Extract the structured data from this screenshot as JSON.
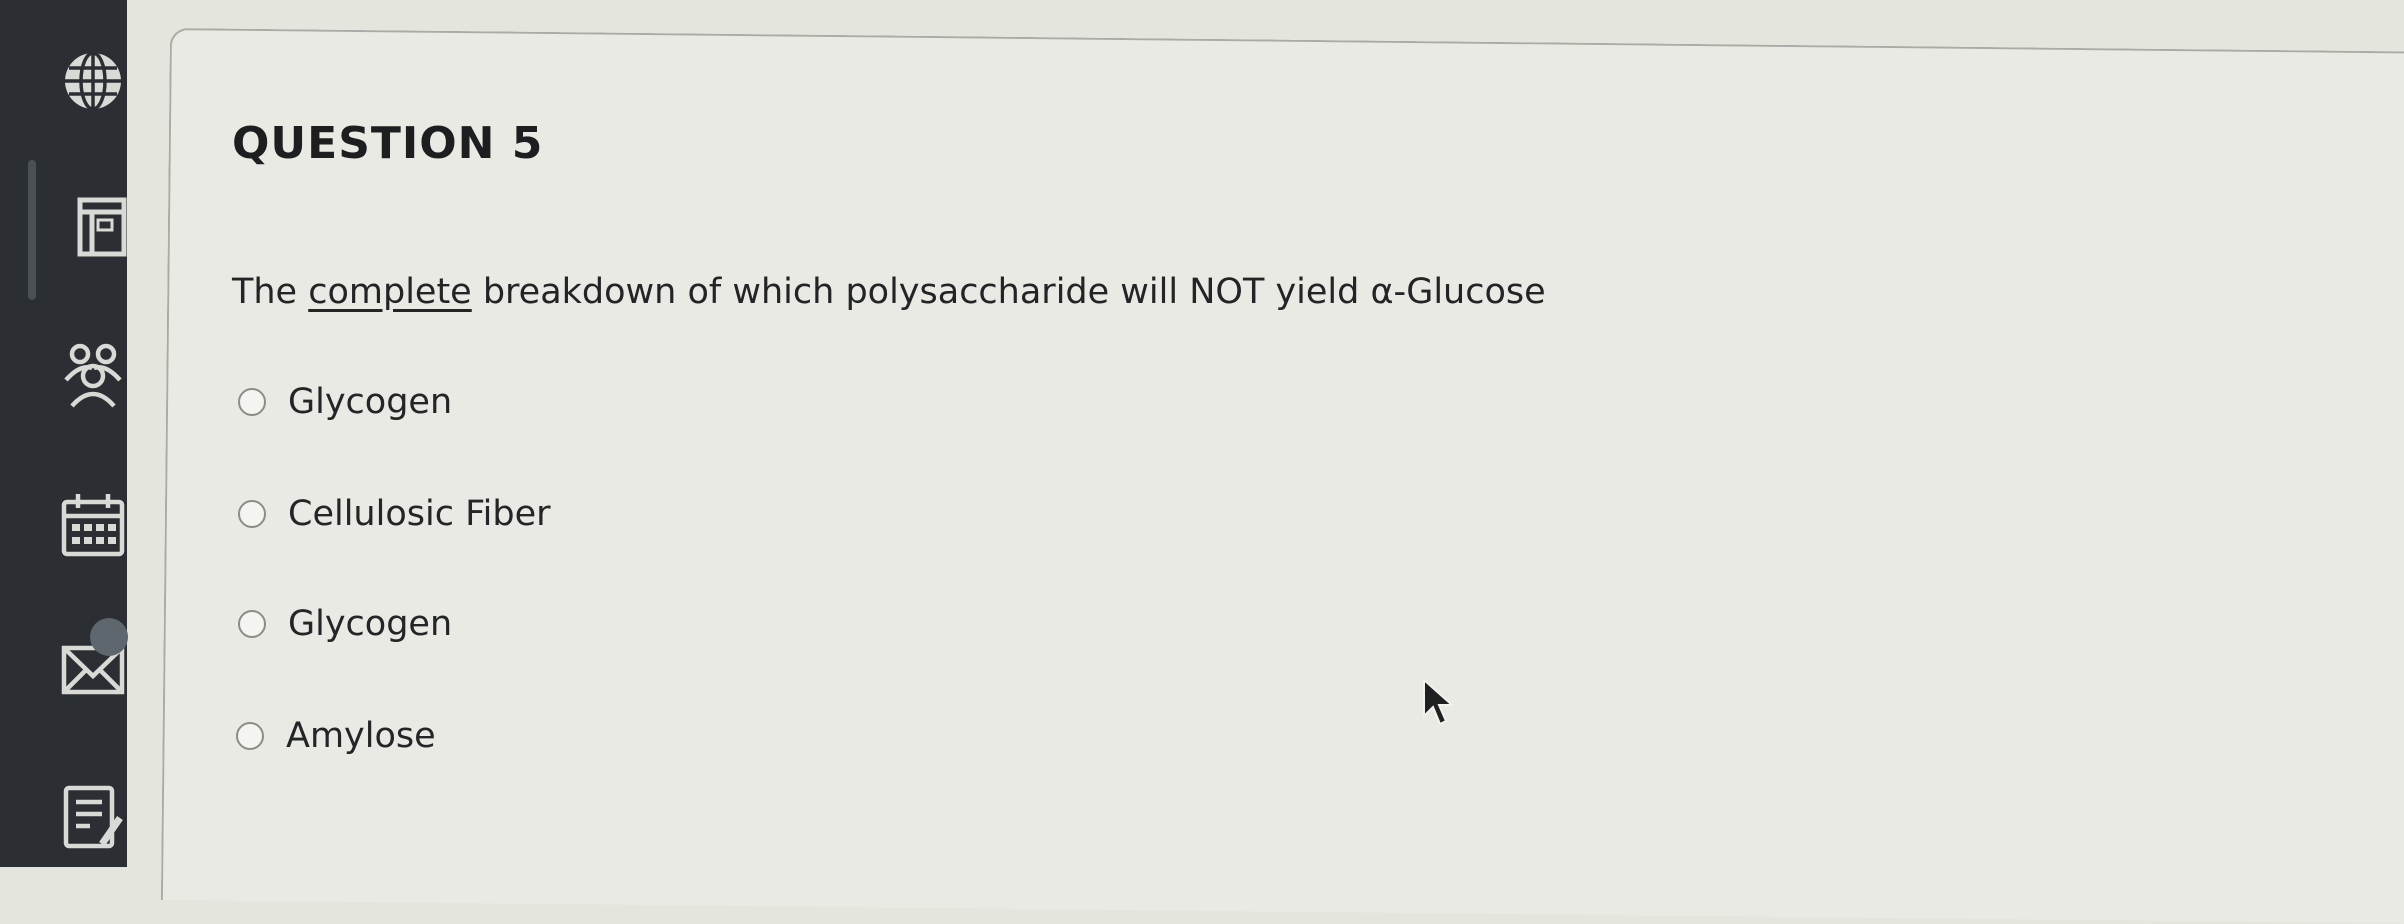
{
  "sidebar": {
    "icons": [
      "globe-icon",
      "courses-icon",
      "groups-icon",
      "calendar-icon",
      "mail-icon",
      "grades-icon"
    ]
  },
  "question": {
    "title": "QUESTION 5",
    "text_before": "The ",
    "text_underlined": "complete",
    "text_after": " breakdown of which polysaccharide will NOT yield α-Glucose"
  },
  "options": [
    {
      "label": "Glycogen"
    },
    {
      "label": "Cellulosic Fiber"
    },
    {
      "label": "Glycogen"
    },
    {
      "label": "Amylose"
    }
  ],
  "colors": {
    "sidebar_bg": "#2b2f33",
    "page_bg": "#e4e5dd"
  }
}
